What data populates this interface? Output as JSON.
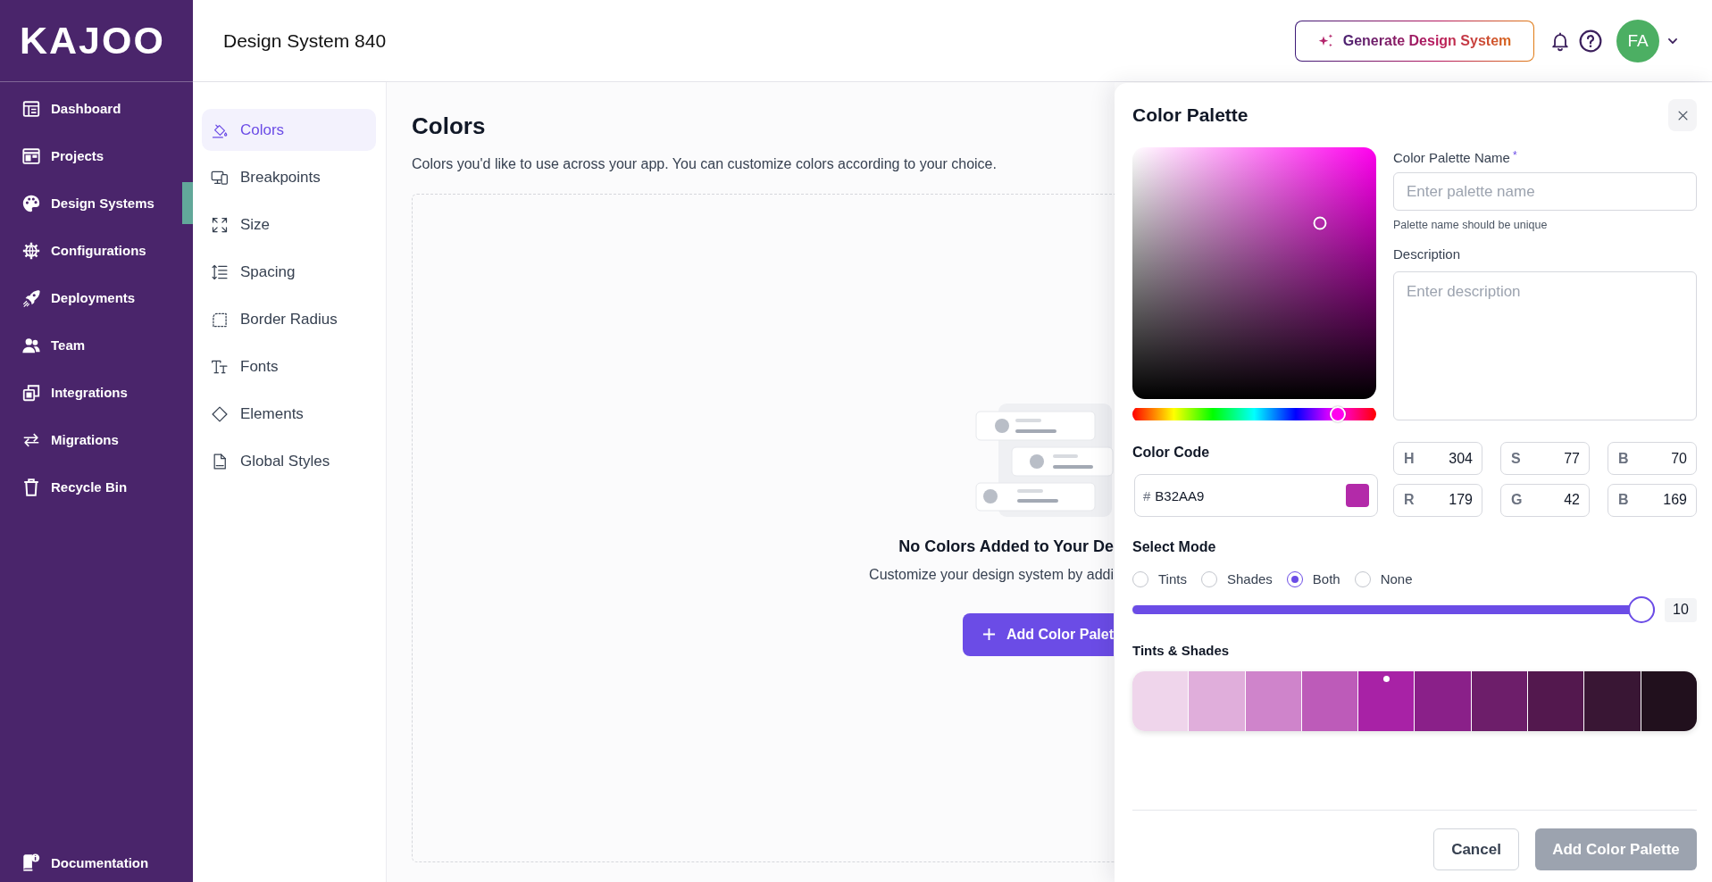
{
  "sidebar": {
    "logo": "KAJOO",
    "nav": [
      {
        "label": "Dashboard",
        "selected": false
      },
      {
        "label": "Projects",
        "selected": false
      },
      {
        "label": "Design Systems",
        "selected": true
      },
      {
        "label": "Configurations",
        "selected": false
      },
      {
        "label": "Deployments",
        "selected": false
      },
      {
        "label": "Team",
        "selected": false
      },
      {
        "label": "Integrations",
        "selected": false
      },
      {
        "label": "Migrations",
        "selected": false
      },
      {
        "label": "Recycle Bin",
        "selected": false
      }
    ],
    "footer_link": "Documentation"
  },
  "topbar": {
    "title": "Design System 840",
    "generate_button": "Generate Design System",
    "avatar": "FA"
  },
  "settings_nav": [
    {
      "label": "Colors",
      "selected": true
    },
    {
      "label": "Breakpoints",
      "selected": false
    },
    {
      "label": "Size",
      "selected": false
    },
    {
      "label": "Spacing",
      "selected": false
    },
    {
      "label": "Border Radius",
      "selected": false
    },
    {
      "label": "Fonts",
      "selected": false
    },
    {
      "label": "Elements",
      "selected": false
    },
    {
      "label": "Global Styles",
      "selected": false
    }
  ],
  "content": {
    "title": "Colors",
    "subtitle": "Colors you'd like to use across your app. You can customize colors according to your choice.",
    "empty_state": {
      "title": "No Colors Added to Your De",
      "text": "Customize your design system by addi",
      "button": "Add Color Palet"
    }
  },
  "panel": {
    "title": "Color Palette",
    "hue_slider": {
      "level": 0.844
    },
    "name_field": {
      "label": "Color Palette Name",
      "required_mark": "*",
      "placeholder": "Enter palette name",
      "hint": "Palette name should be unique"
    },
    "description_field": {
      "label": "Description",
      "placeholder": "Enter description"
    },
    "color_code": {
      "label": "Color Code",
      "prefix": "#",
      "value": "B32AA9"
    },
    "channels": [
      {
        "label": "H",
        "value": "304"
      },
      {
        "label": "S",
        "value": "77"
      },
      {
        "label": "B",
        "value": "70"
      },
      {
        "label": "R",
        "value": "179"
      },
      {
        "label": "G",
        "value": "42"
      },
      {
        "label": "B",
        "value": "169"
      }
    ],
    "mode": {
      "label": "Select Mode",
      "options": [
        {
          "label": "Tints",
          "selected": false
        },
        {
          "label": "Shades",
          "selected": false
        },
        {
          "label": "Both",
          "selected": true
        },
        {
          "label": "None",
          "selected": false
        }
      ]
    },
    "count_slider": {
      "level": 1,
      "reading": "10"
    },
    "swatches": {
      "label": "Tints & Shades",
      "items": [
        {
          "color": "#efd5eb",
          "selected": false
        },
        {
          "color": "#e0aedb",
          "selected": false
        },
        {
          "color": "#cf84cb",
          "selected": false
        },
        {
          "color": "#bd5bb9",
          "selected": false
        },
        {
          "color": "#a822a6",
          "selected": true
        },
        {
          "color": "#8a2089",
          "selected": false
        },
        {
          "color": "#6d1e6a",
          "selected": false
        },
        {
          "color": "#53184e",
          "selected": false
        },
        {
          "color": "#391634",
          "selected": false
        },
        {
          "color": "#21101d",
          "selected": false
        }
      ]
    },
    "buttons": [
      {
        "label": "Cancel",
        "kind": "secondary",
        "disabled": false
      },
      {
        "label": "Add Color Palette",
        "kind": "primary",
        "disabled": true
      }
    ]
  }
}
